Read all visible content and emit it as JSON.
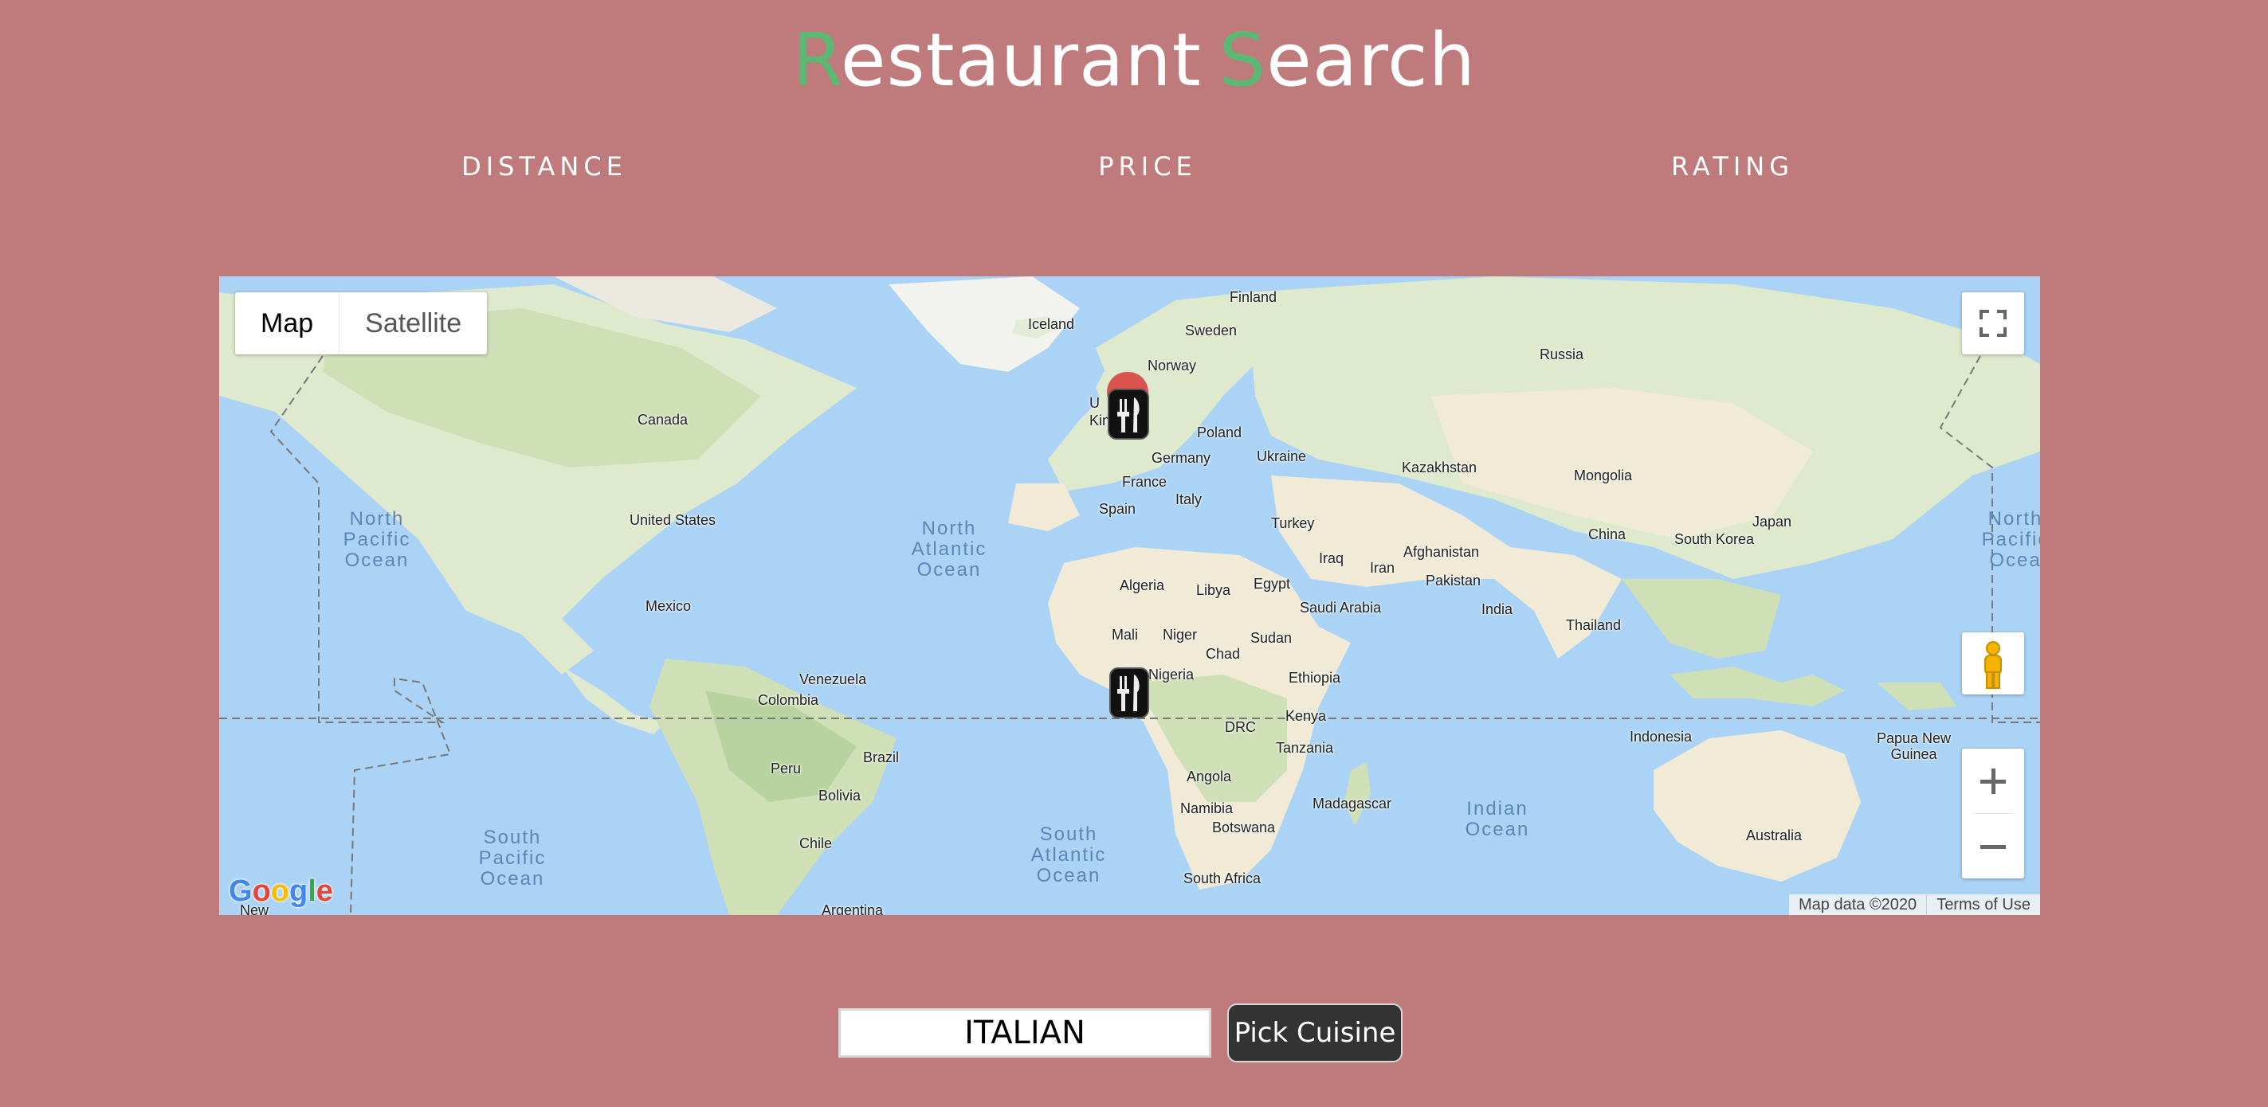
{
  "header": {
    "title_part1_initial": "R",
    "title_part1_rest": "estaurant",
    "title_part2_initial": "S",
    "title_part2_rest": "earch",
    "accent_color": "#5bb974"
  },
  "filters": {
    "distance": "DISTANCE",
    "price": "PRICE",
    "rating": "RATING"
  },
  "map": {
    "type_map": "Map",
    "type_satellite": "Satellite",
    "attribution": "Map data ©2020",
    "terms": "Terms of Use",
    "google_logo": "Google",
    "countries": {
      "iceland": "Iceland",
      "finland": "Finland",
      "sweden": "Sweden",
      "norway": "Norway",
      "russia": "Russia",
      "canada": "Canada",
      "poland": "Poland",
      "germany": "Germany",
      "ukraine": "Ukraine",
      "kazakhstan": "Kazakhstan",
      "mongolia": "Mongolia",
      "france": "France",
      "italy": "Italy",
      "united_states": "United States",
      "spain": "Spain",
      "turkey": "Turkey",
      "iraq": "Iraq",
      "iran": "Iran",
      "afghanistan": "Afghanistan",
      "china": "China",
      "south_korea": "South Korea",
      "japan": "Japan",
      "algeria": "Algeria",
      "libya": "Libya",
      "egypt": "Egypt",
      "pakistan": "Pakistan",
      "mexico": "Mexico",
      "saudi_arabia": "Saudi Arabia",
      "india": "India",
      "mali": "Mali",
      "niger": "Niger",
      "sudan": "Sudan",
      "chad": "Chad",
      "thailand": "Thailand",
      "venezuela": "Venezuela",
      "nigeria": "Nigeria",
      "ethiopia": "Ethiopia",
      "colombia": "Colombia",
      "kenya": "Kenya",
      "drc": "DRC",
      "indonesia": "Indonesia",
      "papua_new_guinea": "Papua New\nGuinea",
      "tanzania": "Tanzania",
      "brazil": "Brazil",
      "peru": "Peru",
      "angola": "Angola",
      "bolivia": "Bolivia",
      "madagascar": "Madagascar",
      "namibia": "Namibia",
      "botswana": "Botswana",
      "australia": "Australia",
      "chile": "Chile",
      "south_africa": "South Africa",
      "argentina": "Argentina",
      "new_zealand": "New",
      "uk_partial": "U\nKin"
    },
    "oceans": {
      "north_pacific_west": "North\nPacific\nOcean",
      "north_atlantic": "North\nAtlantic\nOcean",
      "north_pacific_east": "North\nPacific\nOcea",
      "indian": "Indian\nOcean",
      "south_pacific": "South\nPacific\nOcean",
      "south_atlantic": "South\nAtlantic\nOcean"
    },
    "markers": [
      {
        "name": "restaurant-marker-uk",
        "icon": "utensils-icon"
      },
      {
        "name": "restaurant-marker-gulf-of-guinea",
        "icon": "utensils-icon"
      }
    ]
  },
  "search": {
    "cuisine_value": "ITALIAN",
    "pick_button": "Pick Cuisine"
  }
}
